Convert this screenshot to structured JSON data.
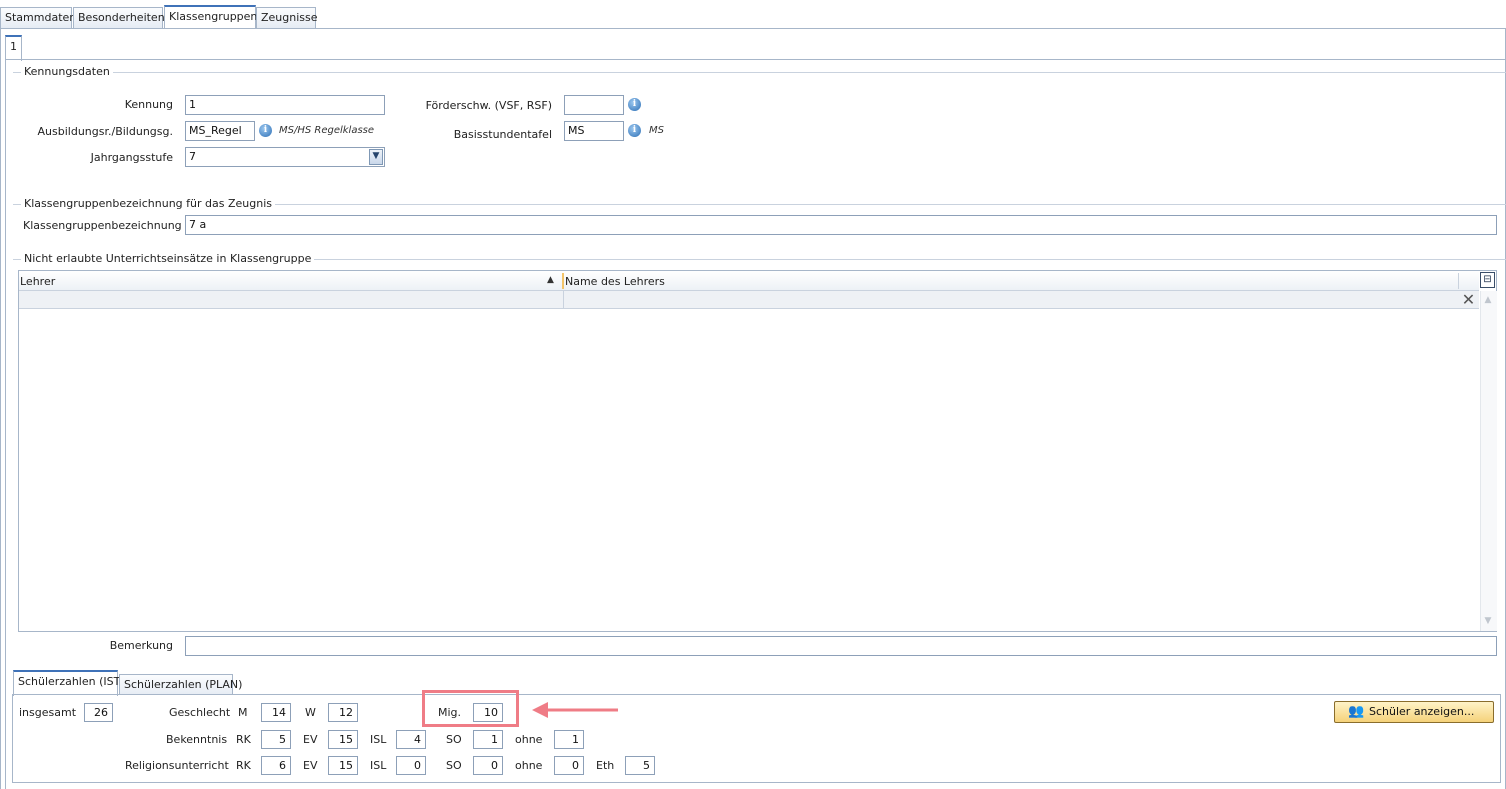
{
  "top_tabs": [
    "Stammdaten",
    "Besonderheiten",
    "Klassengruppen",
    "Zeugnisse"
  ],
  "sub_tab": "1",
  "kennungsdaten": {
    "title": "Kennungsdaten",
    "kennung_label": "Kennung",
    "kennung_value": "1",
    "ausbildung_label": "Ausbildungsr./Bildungsg.",
    "ausbildung_value": "MS_Regel",
    "ausbildung_hint": "MS/HS Regelklasse",
    "jahrgang_label": "Jahrgangsstufe",
    "jahrgang_value": "7",
    "foerder_label": "Förderschw. (VSF, RSF)",
    "foerder_value": "",
    "basis_label": "Basisstundentafel",
    "basis_value": "MS",
    "basis_hint": "MS"
  },
  "bezeichnung": {
    "title": "Klassengruppenbezeichnung für das Zeugnis",
    "label": "Klassengruppenbezeichnung",
    "value": "7 a"
  },
  "unterricht": {
    "title": "Nicht erlaubte Unterrichtseinsätze in Klassengruppe",
    "columns": [
      "Lehrer",
      "Name des Lehrers"
    ],
    "rows": []
  },
  "bemerkung": {
    "label": "Bemerkung",
    "value": ""
  },
  "stats_tabs": [
    "Schülerzahlen (IST)",
    "Schülerzahlen (PLAN)"
  ],
  "stats": {
    "insgesamt_label": "insgesamt",
    "insgesamt": "26",
    "geschlecht_label": "Geschlecht",
    "m_label": "M",
    "m": "14",
    "w_label": "W",
    "w": "12",
    "mig_label": "Mig.",
    "mig": "10",
    "bekenntnis_label": "Bekenntnis",
    "religion_label": "Religionsunterricht",
    "rk_label": "RK",
    "ev_label": "EV",
    "isl_label": "ISL",
    "so_label": "SO",
    "ohne_label": "ohne",
    "eth_label": "Eth",
    "bek": {
      "rk": "5",
      "ev": "15",
      "isl": "4",
      "so": "1",
      "ohne": "1"
    },
    "rel": {
      "rk": "6",
      "ev": "15",
      "isl": "0",
      "so": "0",
      "ohne": "0",
      "eth": "5"
    }
  },
  "show_button": "Schüler anzeigen...",
  "colors": {
    "highlight": "#ef7c86",
    "accent": "#3f72b8"
  }
}
